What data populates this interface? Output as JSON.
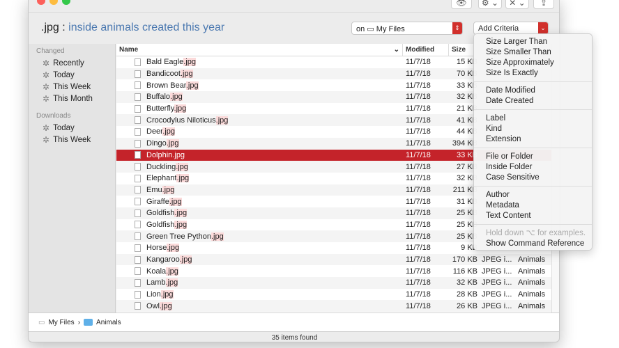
{
  "toolbar": {
    "eye": "👁",
    "gear": "⚙ ⌄",
    "tools": "✕ ⌄",
    "share": "⇪"
  },
  "query": {
    "prefix": ".jpg :",
    "criteria": "inside animals created this year"
  },
  "scope": {
    "prefix": "on",
    "value": "My Files"
  },
  "add_criteria": "Add Criteria",
  "sidebar": {
    "sections": [
      {
        "title": "Changed",
        "items": [
          "Recently",
          "Today",
          "This Week",
          "This Month"
        ]
      },
      {
        "title": "Downloads",
        "items": [
          "Today",
          "This Week"
        ]
      }
    ]
  },
  "columns": {
    "name": "Name",
    "modified": "Modified",
    "size": "Size"
  },
  "rows": [
    {
      "base": "Bald Eagle",
      "ext": ".jpg",
      "modified": "11/7/18",
      "size": "15 KB"
    },
    {
      "base": "Bandicoot",
      "ext": ".jpg",
      "modified": "11/7/18",
      "size": "70 KB"
    },
    {
      "base": "Brown Bear",
      "ext": ".jpg",
      "modified": "11/7/18",
      "size": "33 KB"
    },
    {
      "base": "Buffalo",
      "ext": ".jpg",
      "modified": "11/7/18",
      "size": "32 KB"
    },
    {
      "base": "Butterfly",
      "ext": ".jpg",
      "modified": "11/7/18",
      "size": "21 KB"
    },
    {
      "base": "Crocodylus Niloticus",
      "ext": ".jpg",
      "modified": "11/7/18",
      "size": "41 KB"
    },
    {
      "base": "Deer",
      "ext": ".jpg",
      "modified": "11/7/18",
      "size": "44 KB"
    },
    {
      "base": "Dingo",
      "ext": ".jpg",
      "modified": "11/7/18",
      "size": "394 KB"
    },
    {
      "base": "Dolphin",
      "ext": ".jpg",
      "modified": "11/7/18",
      "size": "33 KB",
      "selected": true
    },
    {
      "base": "Duckling",
      "ext": ".jpg",
      "modified": "11/7/18",
      "size": "27 KB"
    },
    {
      "base": "Elephant",
      "ext": ".jpg",
      "modified": "11/7/18",
      "size": "32 KB"
    },
    {
      "base": "Emu",
      "ext": ".jpg",
      "modified": "11/7/18",
      "size": "211 KB"
    },
    {
      "base": "Giraffe",
      "ext": ".jpg",
      "modified": "11/7/18",
      "size": "31 KB"
    },
    {
      "base": "Goldfish",
      "ext": ".jpg",
      "modified": "11/7/18",
      "size": "25 KB"
    },
    {
      "base": "Goldfish",
      "ext": ".jpg",
      "modified": "11/7/18",
      "size": "25 KB"
    },
    {
      "base": "Green Tree Python",
      "ext": ".jpg",
      "modified": "11/7/18",
      "size": "25 KB"
    },
    {
      "base": "Horse",
      "ext": ".jpg",
      "modified": "11/7/18",
      "size": "9 KB"
    },
    {
      "base": "Kangaroo",
      "ext": ".jpg",
      "modified": "11/7/18",
      "size": "170 KB",
      "kind": "JPEG i...",
      "folder": "Animals"
    },
    {
      "base": "Koala",
      "ext": ".jpg",
      "modified": "11/7/18",
      "size": "116 KB",
      "kind": "JPEG i...",
      "folder": "Animals"
    },
    {
      "base": "Lamb",
      "ext": ".jpg",
      "modified": "11/7/18",
      "size": "32 KB",
      "kind": "JPEG i...",
      "folder": "Animals"
    },
    {
      "base": "Lion",
      "ext": ".jpg",
      "modified": "11/7/18",
      "size": "28 KB",
      "kind": "JPEG i...",
      "folder": "Animals"
    },
    {
      "base": "Owl",
      "ext": ".jpg",
      "modified": "11/7/18",
      "size": "26 KB",
      "kind": "JPEG i...",
      "folder": "Animals"
    }
  ],
  "path": [
    "My Files",
    "Animals"
  ],
  "status": "35 items found",
  "menu": [
    [
      "Size Larger Than",
      "Size Smaller Than",
      "Size Approximately",
      "Size Is Exactly"
    ],
    [
      "Date Modified",
      "Date Created"
    ],
    [
      "Label",
      "Kind",
      "Extension"
    ],
    [
      "File or Folder",
      "Inside Folder",
      "Case Sensitive"
    ],
    [
      "Author",
      "Metadata",
      "Text Content"
    ]
  ],
  "menu_hint": "Hold down ⌥ for examples.",
  "menu_last": "Show Command Reference",
  "colors": {
    "accent": "#c4232a",
    "query": "#4a78b0"
  }
}
